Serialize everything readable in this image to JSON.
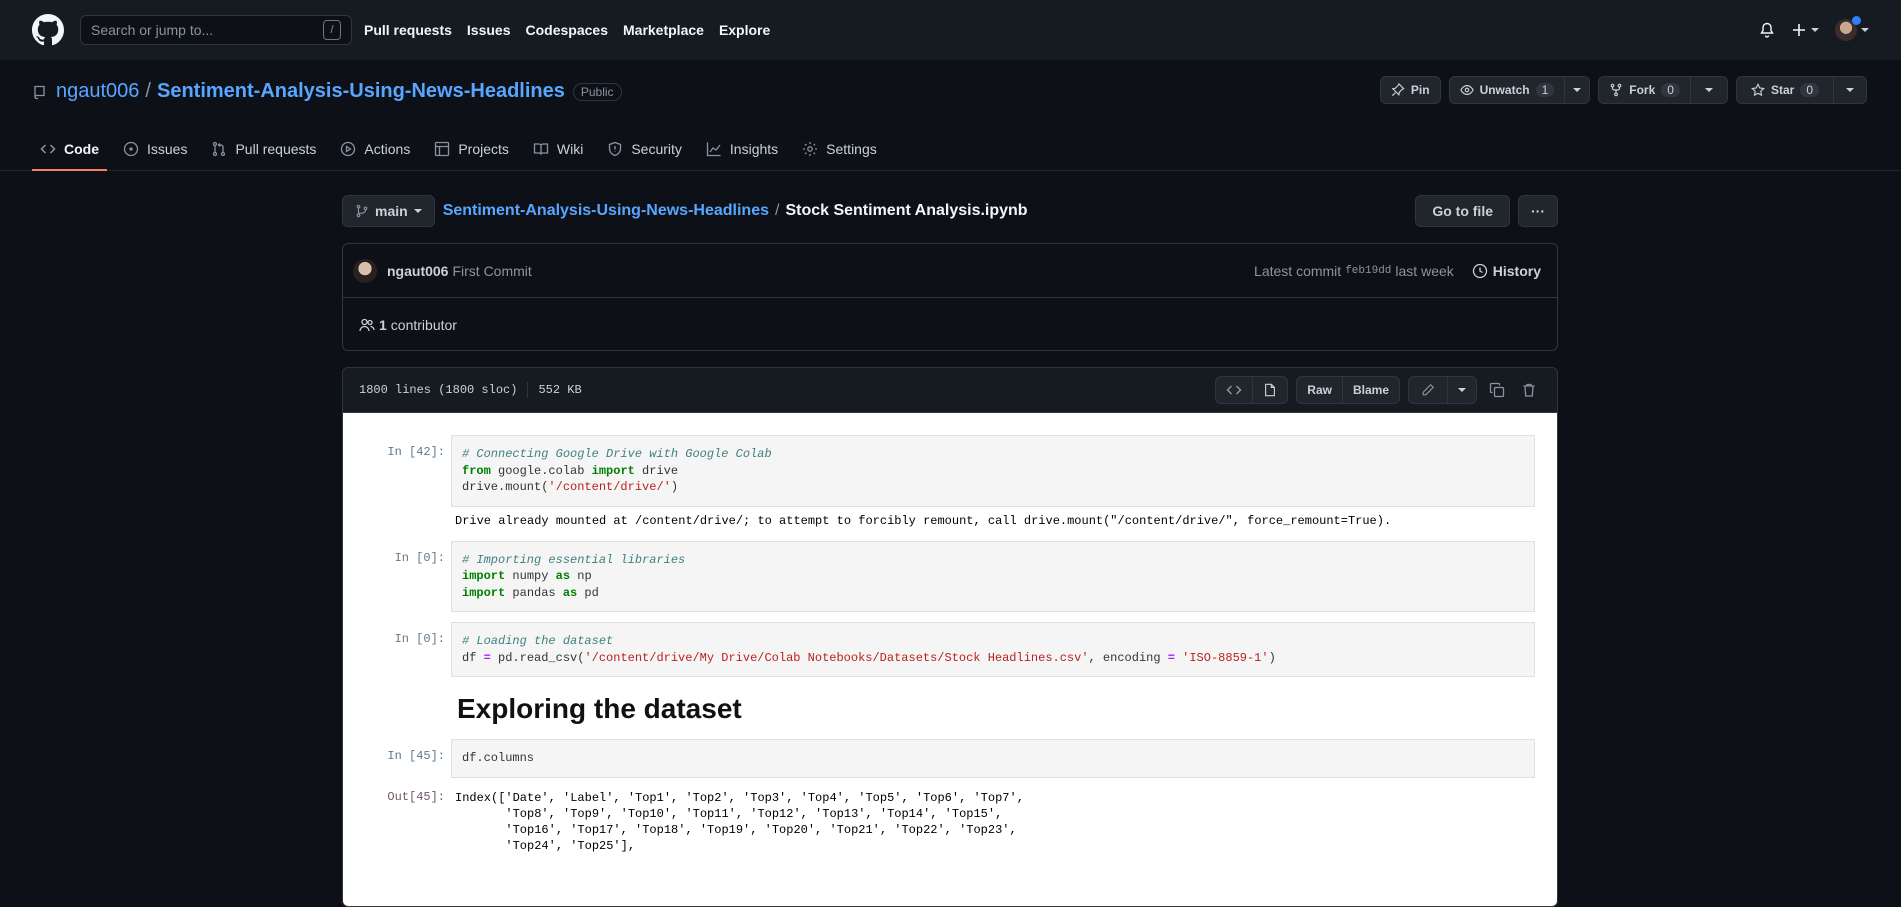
{
  "header": {
    "search_placeholder": "Search or jump to...",
    "search_shortcut": "/",
    "nav": [
      "Pull requests",
      "Issues",
      "Codespaces",
      "Marketplace",
      "Explore"
    ]
  },
  "repo": {
    "owner": "ngaut006",
    "separator": "/",
    "name": "Sentiment-Analysis-Using-News-Headlines",
    "visibility": "Public",
    "actions": {
      "pin": "Pin",
      "unwatch": "Unwatch",
      "unwatch_count": "1",
      "fork": "Fork",
      "fork_count": "0",
      "star": "Star",
      "star_count": "0"
    },
    "tabs": [
      "Code",
      "Issues",
      "Pull requests",
      "Actions",
      "Projects",
      "Wiki",
      "Security",
      "Insights",
      "Settings"
    ]
  },
  "path": {
    "branch": "main",
    "repo_link": "Sentiment-Analysis-Using-News-Headlines",
    "sep": "/",
    "file": "Stock Sentiment Analysis.ipynb",
    "go_to_file": "Go to file",
    "more": "···"
  },
  "commit": {
    "author": "ngaut006",
    "message": "First Commit",
    "latest_label": "Latest commit",
    "sha": "feb19dd",
    "time": "last week",
    "history": "History",
    "contributors_count": "1",
    "contributors_label": "contributor"
  },
  "file": {
    "lines": "1800 lines (1800 sloc)",
    "size": "552 KB",
    "raw": "Raw",
    "blame": "Blame"
  },
  "notebook": {
    "cell1_prompt": "In [42]:",
    "cell1_comment": "# Connecting Google Drive with Google Colab",
    "cell1_kw_from": "from",
    "cell1_mod": " google.colab ",
    "cell1_kw_import": "import",
    "cell1_name": " drive",
    "cell1_call": "drive.mount(",
    "cell1_str": "'/content/drive/'",
    "cell1_close": ")",
    "cell1_output": "Drive already mounted at /content/drive/; to attempt to forcibly remount, call drive.mount(\"/content/drive/\", force_remount=True).",
    "cell2_prompt": "In [0]:",
    "cell2_comment": "# Importing essential libraries",
    "cell2_kw_import1": "import",
    "cell2_mod1": " numpy ",
    "cell2_kw_as1": "as",
    "cell2_alias1": " np",
    "cell2_kw_import2": "import",
    "cell2_mod2": " pandas ",
    "cell2_kw_as2": "as",
    "cell2_alias2": " pd",
    "cell3_prompt": "In [0]:",
    "cell3_comment": "# Loading the dataset",
    "cell3_lhs": "df ",
    "cell3_eq": "=",
    "cell3_call": " pd.read_csv(",
    "cell3_path": "'/content/drive/My Drive/Colab Notebooks/Datasets/Stock Headlines.csv'",
    "cell3_mid": ", encoding ",
    "cell3_eq2": "=",
    "cell3_enc": " 'ISO-8859-1'",
    "cell3_close": ")",
    "heading": "Exploring the dataset",
    "cell4_prompt": "In [45]:",
    "cell4_code": "df.columns",
    "cell4_out_prompt": "Out[45]:",
    "cell4_output": "Index(['Date', 'Label', 'Top1', 'Top2', 'Top3', 'Top4', 'Top5', 'Top6', 'Top7',\n       'Top8', 'Top9', 'Top10', 'Top11', 'Top12', 'Top13', 'Top14', 'Top15',\n       'Top16', 'Top17', 'Top18', 'Top19', 'Top20', 'Top21', 'Top22', 'Top23',\n       'Top24', 'Top25'],"
  },
  "colors": {
    "background": "#0d1117",
    "link": "#58a6ff",
    "active_tab_underline": "#f78166",
    "notification_dot": "#2f81f7"
  },
  "icons": [
    "github-logo-icon",
    "bell-icon",
    "plus-icon",
    "repo-icon",
    "pin-icon",
    "eye-icon",
    "fork-icon",
    "star-icon",
    "code-icon",
    "issue-icon",
    "pull-request-icon",
    "play-icon",
    "table-icon",
    "book-icon",
    "shield-icon",
    "graph-icon",
    "gear-icon",
    "branch-icon",
    "history-icon",
    "people-icon",
    "file-icon",
    "pencil-icon",
    "copy-icon",
    "trash-icon"
  ]
}
